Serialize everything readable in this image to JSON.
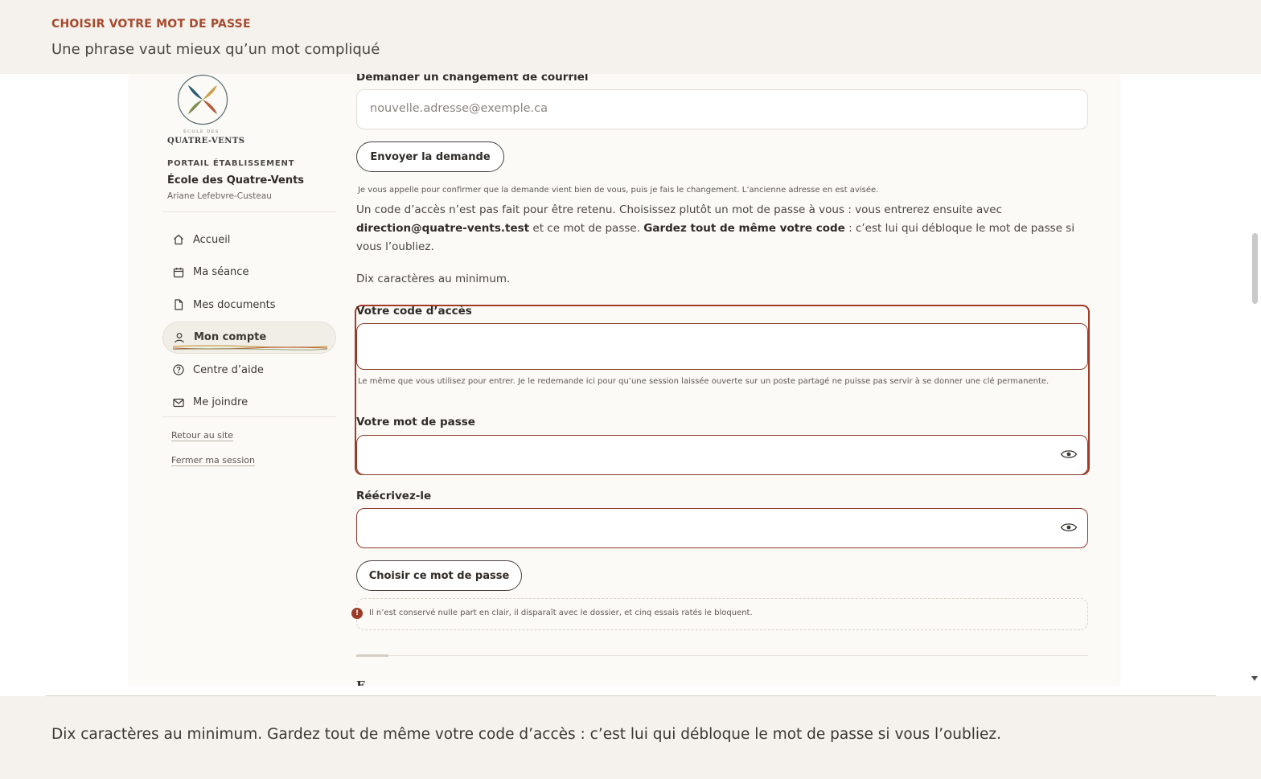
{
  "header": {
    "kicker": "CHOISIR VOTRE MOT DE PASSE",
    "title": "Une phrase vaut mieux qu’un mot compliqué"
  },
  "sidebar": {
    "logo_small": "ÉCOLE DES",
    "logo_name": "QUATRE-VENTS",
    "portal_kicker": "PORTAIL ÉTABLISSEMENT",
    "school": "École des Quatre-Vents",
    "person": "Ariane Lefebvre-Custeau",
    "items": [
      {
        "label": "Accueil",
        "icon": "home-icon",
        "active": false
      },
      {
        "label": "Ma séance",
        "icon": "calendar-icon",
        "active": false
      },
      {
        "label": "Mes documents",
        "icon": "document-icon",
        "active": false
      },
      {
        "label": "Mon compte",
        "icon": "user-icon",
        "active": true
      },
      {
        "label": "Centre d’aide",
        "icon": "help-icon",
        "active": false
      },
      {
        "label": "Me joindre",
        "icon": "mail-icon",
        "active": false
      }
    ],
    "back_link": "Retour au site",
    "logout_link": "Fermer ma session"
  },
  "email_change": {
    "label": "Demander un changement de courriel",
    "placeholder": "nouvelle.adresse@exemple.ca",
    "button": "Envoyer la demande",
    "hint": "Je vous appelle pour confirmer que la demande vient bien de vous, puis je fais le changement. L’ancienne adresse en est avisée."
  },
  "password_intro": {
    "text_1": "Un code d’accès n’est pas fait pour être retenu. Choisissez plutôt un mot de passe à vous : vous entrerez ensuite avec ",
    "email": "direction@quatre-vents.test",
    "text_2": " et ce mot de passe. ",
    "strong": "Gardez tout de même votre code",
    "text_3": " : c’est lui qui débloque le mot de passe si vous l’oubliez.",
    "min_chars": "Dix caractères au minimum."
  },
  "form": {
    "code_label": "Votre code d’accès",
    "code_value": "",
    "code_hint": "Le même que vous utilisez pour entrer. Je le redemande ici pour qu’une session laissée ouverte sur un poste partagé ne puisse pas servir à se donner une clé permanente.",
    "password_label": "Votre mot de passe",
    "password_value": "",
    "repeat_label": "Réécrivez-le",
    "repeat_value": "",
    "submit": "Choisir ce mot de passe",
    "note": "Il n’est conservé nulle part en clair, il disparaît avec le dossier, et cinq essais ratés le bloquent.",
    "note_icon": "!"
  },
  "cut_heading": "F",
  "footer": {
    "caption": "Dix caractères au minimum. Gardez tout de même votre code d’accès : c’est lui qui débloque le mot de passe si vous l’oubliez."
  },
  "colors": {
    "accent": "#a64a2e",
    "highlight": "#a13a27",
    "band": "#f5f1ec",
    "card": "#fbfaf7"
  }
}
